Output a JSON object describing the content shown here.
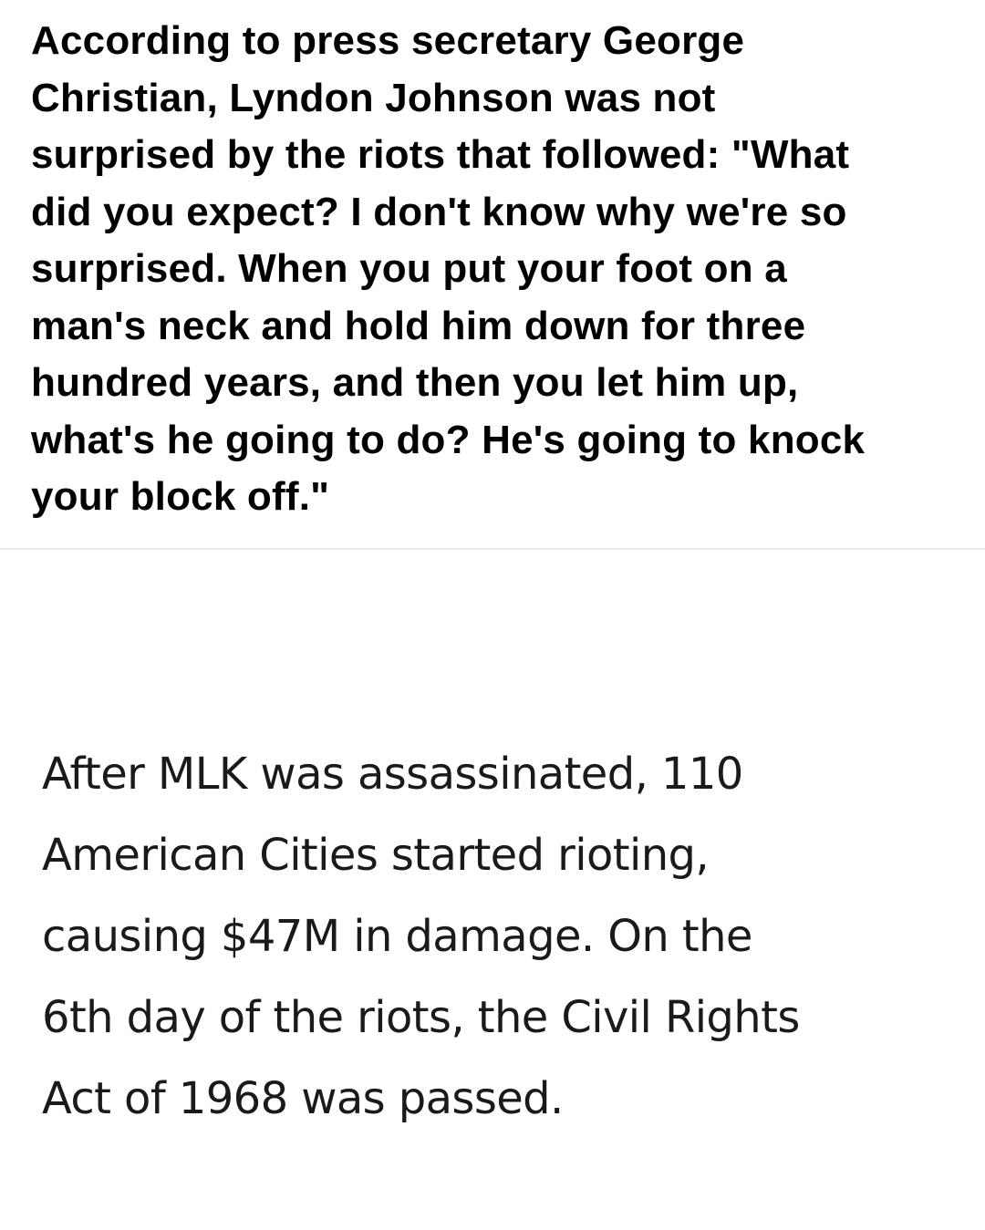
{
  "top_quote": {
    "lines": [
      "According to press secretary George",
      "Christian, Lyndon Johnson was not",
      "surprised by the riots that followed: \"What",
      "did you expect? I don't know why we're so",
      "surprised. When you put your foot on a",
      "man's neck and hold him down for three",
      "hundred years, and then you let him up,",
      "what's he going to do? He's going to knock",
      "your block off.\""
    ]
  },
  "bottom_tweet": {
    "lines": [
      "After MLK was assassinated, 110",
      "American Cities started rioting,",
      "causing $47M in damage. On the",
      "6th day of the riots, the Civil Rights",
      "Act of 1968 was passed."
    ]
  }
}
